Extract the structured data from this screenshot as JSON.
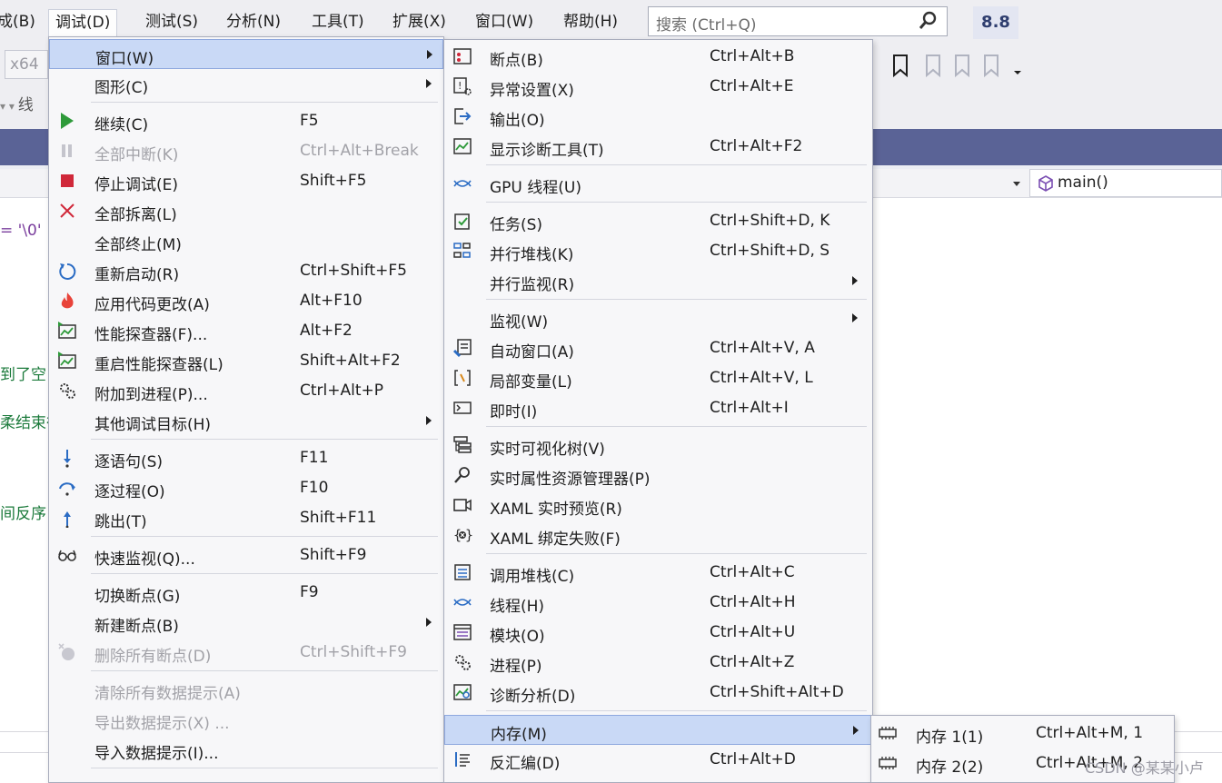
{
  "menubar": {
    "items": [
      "成(B)",
      "调试(D)",
      "测试(S)",
      "分析(N)",
      "工具(T)",
      "扩展(X)",
      "窗口(W)",
      "帮助(H)"
    ],
    "search_placeholder": "搜索 (Ctrl+Q)",
    "version": "8.8"
  },
  "toolbar": {
    "platform": "x64",
    "thread_label": "线"
  },
  "nav": {
    "function": "main()"
  },
  "editor": {
    "lines": [
      "= '\\0'",
      "到了空",
      "柔结束往",
      "间反序"
    ]
  },
  "debug_menu": {
    "items": [
      {
        "label": "窗口(W)",
        "shortcut": "",
        "icon": "none",
        "submenu": true,
        "disabled": false,
        "highlighted": true
      },
      {
        "label": "图形(C)",
        "shortcut": "",
        "icon": "none",
        "submenu": true,
        "disabled": false
      },
      {
        "label": "继续(C)",
        "shortcut": "F5",
        "icon": "play-icon",
        "disabled": false
      },
      {
        "label": "全部中断(K)",
        "shortcut": "Ctrl+Alt+Break",
        "icon": "pause-icon",
        "disabled": true
      },
      {
        "label": "停止调试(E)",
        "shortcut": "Shift+F5",
        "icon": "stop-icon",
        "disabled": false
      },
      {
        "label": "全部拆离(L)",
        "shortcut": "",
        "icon": "detach-icon",
        "disabled": false
      },
      {
        "label": "全部终止(M)",
        "shortcut": "",
        "icon": "none",
        "disabled": false
      },
      {
        "label": "重新启动(R)",
        "shortcut": "Ctrl+Shift+F5",
        "icon": "restart-icon",
        "disabled": false
      },
      {
        "label": "应用代码更改(A)",
        "shortcut": "Alt+F10",
        "icon": "hot-reload-icon",
        "disabled": false
      },
      {
        "label": "性能探查器(F)...",
        "shortcut": "Alt+F2",
        "icon": "profiler-icon",
        "disabled": false
      },
      {
        "label": "重启性能探查器(L)",
        "shortcut": "Shift+Alt+F2",
        "icon": "profiler-icon",
        "disabled": false
      },
      {
        "label": "附加到进程(P)...",
        "shortcut": "Ctrl+Alt+P",
        "icon": "gears-icon",
        "disabled": false
      },
      {
        "label": "其他调试目标(H)",
        "shortcut": "",
        "icon": "none",
        "submenu": true,
        "disabled": false
      },
      {
        "label": "逐语句(S)",
        "shortcut": "F11",
        "icon": "step-into-icon",
        "disabled": false
      },
      {
        "label": "逐过程(O)",
        "shortcut": "F10",
        "icon": "step-over-icon",
        "disabled": false
      },
      {
        "label": "跳出(T)",
        "shortcut": "Shift+F11",
        "icon": "step-out-icon",
        "disabled": false
      },
      {
        "label": "快速监视(Q)...",
        "shortcut": "Shift+F9",
        "icon": "glasses-icon",
        "disabled": false
      },
      {
        "label": "切换断点(G)",
        "shortcut": "F9",
        "icon": "none",
        "disabled": false
      },
      {
        "label": "新建断点(B)",
        "shortcut": "",
        "icon": "none",
        "submenu": true,
        "disabled": false
      },
      {
        "label": "删除所有断点(D)",
        "shortcut": "Ctrl+Shift+F9",
        "icon": "delete-breakpoints-icon",
        "disabled": true
      },
      {
        "label": "清除所有数据提示(A)",
        "shortcut": "",
        "icon": "none",
        "disabled": true
      },
      {
        "label": "导出数据提示(X) ...",
        "shortcut": "",
        "icon": "none",
        "disabled": true
      },
      {
        "label": "导入数据提示(I)...",
        "shortcut": "",
        "icon": "none",
        "disabled": false
      }
    ]
  },
  "window_menu": {
    "items": [
      {
        "label": "断点(B)",
        "shortcut": "Ctrl+Alt+B",
        "icon": "breakpoints-window-icon"
      },
      {
        "label": "异常设置(X)",
        "shortcut": "Ctrl+Alt+E",
        "icon": "exception-settings-icon"
      },
      {
        "label": "输出(O)",
        "shortcut": "",
        "icon": "output-icon"
      },
      {
        "label": "显示诊断工具(T)",
        "shortcut": "Ctrl+Alt+F2",
        "icon": "diagnostics-icon"
      },
      {
        "label": "GPU 线程(U)",
        "shortcut": "",
        "icon": "threads-icon"
      },
      {
        "label": "任务(S)",
        "shortcut": "Ctrl+Shift+D, K",
        "icon": "tasks-icon"
      },
      {
        "label": "并行堆栈(K)",
        "shortcut": "Ctrl+Shift+D, S",
        "icon": "parallel-stacks-icon"
      },
      {
        "label": "并行监视(R)",
        "shortcut": "",
        "icon": "none",
        "submenu": true
      },
      {
        "label": "监视(W)",
        "shortcut": "",
        "icon": "none",
        "submenu": true
      },
      {
        "label": "自动窗口(A)",
        "shortcut": "Ctrl+Alt+V, A",
        "icon": "autos-icon"
      },
      {
        "label": "局部变量(L)",
        "shortcut": "Ctrl+Alt+V, L",
        "icon": "locals-icon"
      },
      {
        "label": "即时(I)",
        "shortcut": "Ctrl+Alt+I",
        "icon": "immediate-icon"
      },
      {
        "label": "实时可视化树(V)",
        "shortcut": "",
        "icon": "visual-tree-icon"
      },
      {
        "label": "实时属性资源管理器(P)",
        "shortcut": "",
        "icon": "property-explorer-icon"
      },
      {
        "label": "XAML 实时预览(R)",
        "shortcut": "",
        "icon": "xaml-preview-icon"
      },
      {
        "label": "XAML 绑定失败(F)",
        "shortcut": "",
        "icon": "xaml-binding-icon"
      },
      {
        "label": "调用堆栈(C)",
        "shortcut": "Ctrl+Alt+C",
        "icon": "call-stack-icon"
      },
      {
        "label": "线程(H)",
        "shortcut": "Ctrl+Alt+H",
        "icon": "threads-icon"
      },
      {
        "label": "模块(O)",
        "shortcut": "Ctrl+Alt+U",
        "icon": "modules-icon"
      },
      {
        "label": "进程(P)",
        "shortcut": "Ctrl+Alt+Z",
        "icon": "gears-icon"
      },
      {
        "label": "诊断分析(D)",
        "shortcut": "Ctrl+Shift+Alt+D",
        "icon": "diagnostic-analysis-icon"
      },
      {
        "label": "内存(M)",
        "shortcut": "",
        "icon": "none",
        "submenu": true,
        "highlighted": true
      },
      {
        "label": "反汇编(D)",
        "shortcut": "Ctrl+Alt+D",
        "icon": "disassembly-icon"
      }
    ]
  },
  "memory_menu": {
    "items": [
      {
        "label": "内存 1(1)",
        "shortcut": "Ctrl+Alt+M, 1",
        "icon": "memory-chip-icon"
      },
      {
        "label": "内存 2(2)",
        "shortcut": "Ctrl+Alt+M, 2",
        "icon": "memory-chip-icon"
      }
    ]
  },
  "watermark": "CSDN @某某小卢",
  "colors": {
    "accent": "#5a6396",
    "highlight": "#c9d9f6",
    "play": "#2e9a3a",
    "stop": "#d0283a",
    "icon_blue": "#2b6cc4"
  }
}
